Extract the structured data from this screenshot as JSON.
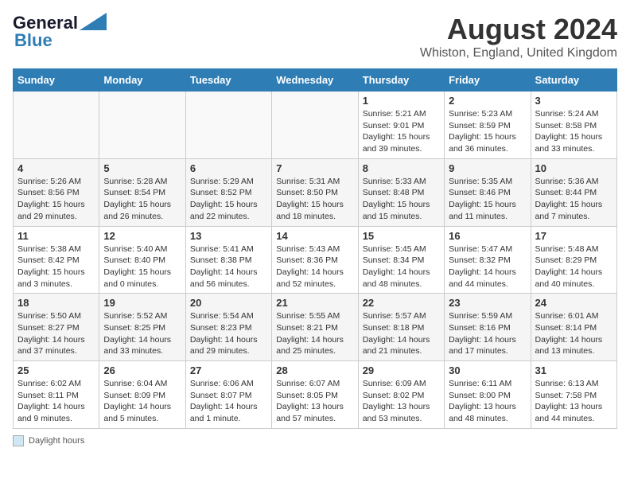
{
  "logo": {
    "line1": "General",
    "line2": "Blue"
  },
  "title": "August 2024",
  "subtitle": "Whiston, England, United Kingdom",
  "days_of_week": [
    "Sunday",
    "Monday",
    "Tuesday",
    "Wednesday",
    "Thursday",
    "Friday",
    "Saturday"
  ],
  "weeks": [
    [
      {
        "day": "",
        "info": ""
      },
      {
        "day": "",
        "info": ""
      },
      {
        "day": "",
        "info": ""
      },
      {
        "day": "",
        "info": ""
      },
      {
        "day": "1",
        "info": "Sunrise: 5:21 AM\nSunset: 9:01 PM\nDaylight: 15 hours\nand 39 minutes."
      },
      {
        "day": "2",
        "info": "Sunrise: 5:23 AM\nSunset: 8:59 PM\nDaylight: 15 hours\nand 36 minutes."
      },
      {
        "day": "3",
        "info": "Sunrise: 5:24 AM\nSunset: 8:58 PM\nDaylight: 15 hours\nand 33 minutes."
      }
    ],
    [
      {
        "day": "4",
        "info": "Sunrise: 5:26 AM\nSunset: 8:56 PM\nDaylight: 15 hours\nand 29 minutes."
      },
      {
        "day": "5",
        "info": "Sunrise: 5:28 AM\nSunset: 8:54 PM\nDaylight: 15 hours\nand 26 minutes."
      },
      {
        "day": "6",
        "info": "Sunrise: 5:29 AM\nSunset: 8:52 PM\nDaylight: 15 hours\nand 22 minutes."
      },
      {
        "day": "7",
        "info": "Sunrise: 5:31 AM\nSunset: 8:50 PM\nDaylight: 15 hours\nand 18 minutes."
      },
      {
        "day": "8",
        "info": "Sunrise: 5:33 AM\nSunset: 8:48 PM\nDaylight: 15 hours\nand 15 minutes."
      },
      {
        "day": "9",
        "info": "Sunrise: 5:35 AM\nSunset: 8:46 PM\nDaylight: 15 hours\nand 11 minutes."
      },
      {
        "day": "10",
        "info": "Sunrise: 5:36 AM\nSunset: 8:44 PM\nDaylight: 15 hours\nand 7 minutes."
      }
    ],
    [
      {
        "day": "11",
        "info": "Sunrise: 5:38 AM\nSunset: 8:42 PM\nDaylight: 15 hours\nand 3 minutes."
      },
      {
        "day": "12",
        "info": "Sunrise: 5:40 AM\nSunset: 8:40 PM\nDaylight: 15 hours\nand 0 minutes."
      },
      {
        "day": "13",
        "info": "Sunrise: 5:41 AM\nSunset: 8:38 PM\nDaylight: 14 hours\nand 56 minutes."
      },
      {
        "day": "14",
        "info": "Sunrise: 5:43 AM\nSunset: 8:36 PM\nDaylight: 14 hours\nand 52 minutes."
      },
      {
        "day": "15",
        "info": "Sunrise: 5:45 AM\nSunset: 8:34 PM\nDaylight: 14 hours\nand 48 minutes."
      },
      {
        "day": "16",
        "info": "Sunrise: 5:47 AM\nSunset: 8:32 PM\nDaylight: 14 hours\nand 44 minutes."
      },
      {
        "day": "17",
        "info": "Sunrise: 5:48 AM\nSunset: 8:29 PM\nDaylight: 14 hours\nand 40 minutes."
      }
    ],
    [
      {
        "day": "18",
        "info": "Sunrise: 5:50 AM\nSunset: 8:27 PM\nDaylight: 14 hours\nand 37 minutes."
      },
      {
        "day": "19",
        "info": "Sunrise: 5:52 AM\nSunset: 8:25 PM\nDaylight: 14 hours\nand 33 minutes."
      },
      {
        "day": "20",
        "info": "Sunrise: 5:54 AM\nSunset: 8:23 PM\nDaylight: 14 hours\nand 29 minutes."
      },
      {
        "day": "21",
        "info": "Sunrise: 5:55 AM\nSunset: 8:21 PM\nDaylight: 14 hours\nand 25 minutes."
      },
      {
        "day": "22",
        "info": "Sunrise: 5:57 AM\nSunset: 8:18 PM\nDaylight: 14 hours\nand 21 minutes."
      },
      {
        "day": "23",
        "info": "Sunrise: 5:59 AM\nSunset: 8:16 PM\nDaylight: 14 hours\nand 17 minutes."
      },
      {
        "day": "24",
        "info": "Sunrise: 6:01 AM\nSunset: 8:14 PM\nDaylight: 14 hours\nand 13 minutes."
      }
    ],
    [
      {
        "day": "25",
        "info": "Sunrise: 6:02 AM\nSunset: 8:11 PM\nDaylight: 14 hours\nand 9 minutes."
      },
      {
        "day": "26",
        "info": "Sunrise: 6:04 AM\nSunset: 8:09 PM\nDaylight: 14 hours\nand 5 minutes."
      },
      {
        "day": "27",
        "info": "Sunrise: 6:06 AM\nSunset: 8:07 PM\nDaylight: 14 hours\nand 1 minute."
      },
      {
        "day": "28",
        "info": "Sunrise: 6:07 AM\nSunset: 8:05 PM\nDaylight: 13 hours\nand 57 minutes."
      },
      {
        "day": "29",
        "info": "Sunrise: 6:09 AM\nSunset: 8:02 PM\nDaylight: 13 hours\nand 53 minutes."
      },
      {
        "day": "30",
        "info": "Sunrise: 6:11 AM\nSunset: 8:00 PM\nDaylight: 13 hours\nand 48 minutes."
      },
      {
        "day": "31",
        "info": "Sunrise: 6:13 AM\nSunset: 7:58 PM\nDaylight: 13 hours\nand 44 minutes."
      }
    ]
  ],
  "footer": {
    "box_label": "Daylight hours"
  }
}
